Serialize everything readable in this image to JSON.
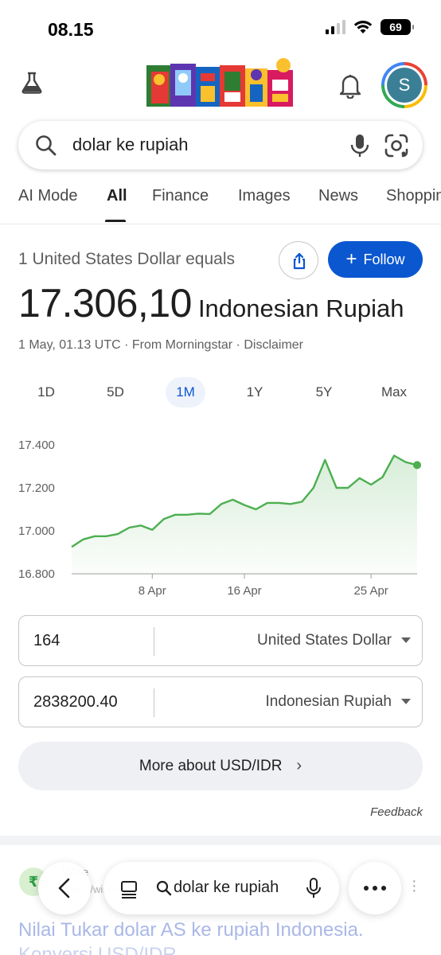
{
  "status_bar": {
    "time": "08.15",
    "battery": "69"
  },
  "search": {
    "query": "dolar ke rupiah"
  },
  "tabs": [
    {
      "label": "AI Mode"
    },
    {
      "label": "All",
      "active": true
    },
    {
      "label": "Finance"
    },
    {
      "label": "Images"
    },
    {
      "label": "News"
    },
    {
      "label": "Shopping"
    }
  ],
  "converter": {
    "equals_text": "1 United States Dollar equals",
    "follow_label": "Follow",
    "rate_value": "17.306,10",
    "rate_currency": "Indonesian Rupiah",
    "meta": "1 May, 01.13 UTC · From Morningstar · Disclaimer",
    "ranges": [
      "1D",
      "5D",
      "1M",
      "1Y",
      "5Y",
      "Max"
    ],
    "active_range": "1M",
    "from_amount": "164",
    "from_currency": "United States Dollar",
    "to_amount": "2838200.40",
    "to_currency": "Indonesian Rupiah",
    "more_label": "More about USD/IDR",
    "feedback_label": "Feedback"
  },
  "chart_data": {
    "type": "area",
    "color": "#4caf50",
    "y_ticks": [
      "17.400",
      "17.200",
      "17.000",
      "16.800"
    ],
    "y_tick_values": [
      17400,
      17200,
      17000,
      16800
    ],
    "x_ticks": [
      "8 Apr",
      "16 Apr",
      "25 Apr"
    ],
    "x_tick_index": [
      7,
      15,
      26
    ],
    "ylim": [
      16800,
      17400
    ],
    "values": [
      16925,
      16960,
      16975,
      16975,
      16985,
      17015,
      17025,
      17005,
      17055,
      17075,
      17075,
      17080,
      17078,
      17125,
      17145,
      17120,
      17100,
      17130,
      17130,
      17125,
      17135,
      17200,
      17330,
      17200,
      17200,
      17245,
      17215,
      17250,
      17350,
      17320,
      17306
    ],
    "grid": false
  },
  "result": {
    "favicon_glyph": "₹",
    "site": "Wise",
    "url": "https://wise.com",
    "title": "Nilai Tukar dolar AS ke rupiah Indonesia.",
    "subtitle": "Konversi USD/IDR"
  },
  "bottom_bar": {
    "query": "dolar ke rupiah"
  }
}
